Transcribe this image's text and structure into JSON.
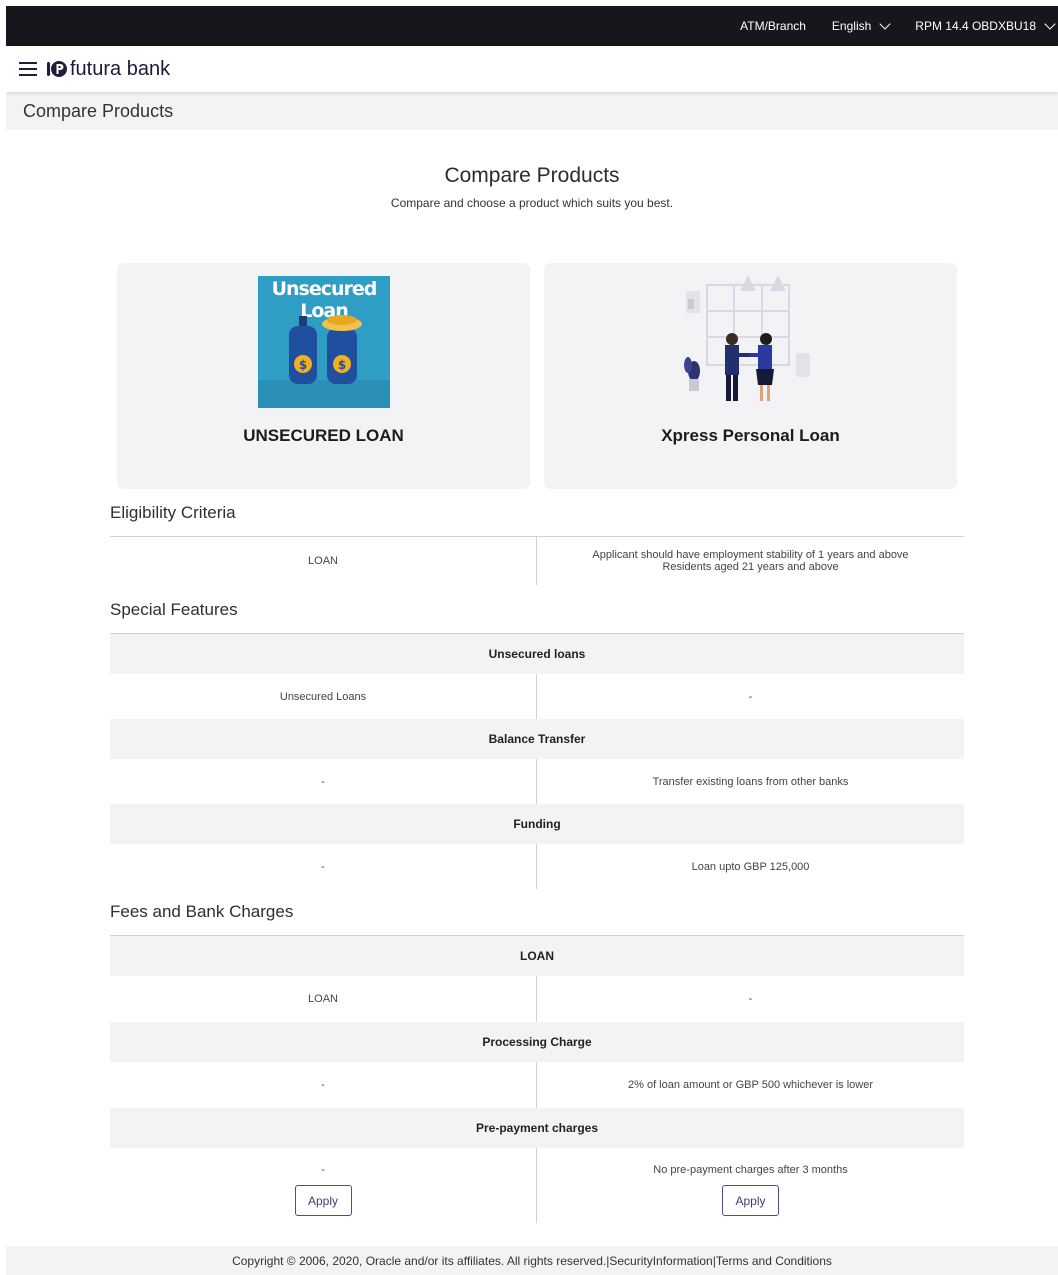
{
  "topbar": {
    "atm_branch": "ATM/Branch",
    "language": "English",
    "user": "RPM 14.4 OBDXBU18"
  },
  "header": {
    "logo_text": "futura bank"
  },
  "page_title": "Compare Products",
  "main": {
    "title": "Compare Products",
    "subtitle": "Compare and choose a product which suits you best."
  },
  "products": [
    {
      "name": "UNSECURED LOAN",
      "image_text": "Unsecured Loan"
    },
    {
      "name": "Xpress Personal Loan"
    }
  ],
  "eligibility": {
    "title": "Eligibility Criteria",
    "left": "LOAN",
    "right_lines": [
      "Applicant should have employment stability of 1 years and above",
      "Residents aged 21 years and above"
    ]
  },
  "special_features": {
    "title": "Special Features",
    "groups": [
      {
        "heading": "Unsecured loans",
        "left": "Unsecured Loans",
        "right": "-"
      },
      {
        "heading": "Balance Transfer",
        "left": "-",
        "right": "Transfer existing loans from other banks"
      },
      {
        "heading": "Funding",
        "left": "-",
        "right": "Loan upto GBP 125,000"
      }
    ]
  },
  "fees": {
    "title": "Fees and Bank Charges",
    "groups": [
      {
        "heading": "LOAN",
        "left": "LOAN",
        "right": "-"
      },
      {
        "heading": "Processing Charge",
        "left": "-",
        "right": "2% of loan amount or GBP 500 whichever is lower"
      },
      {
        "heading": "Pre-payment charges",
        "left": "-",
        "right": "No pre-payment charges after 3 months"
      }
    ]
  },
  "apply_label": "Apply",
  "footer": {
    "text": "Copyright © 2006, 2020, Oracle and/or its affiliates. All rights reserved.|SecurityInformation|Terms and Conditions"
  },
  "colors": {
    "topbar_bg": "#16171d",
    "panel_bg": "#f3f3f6",
    "accent": "#4a4f8a"
  }
}
